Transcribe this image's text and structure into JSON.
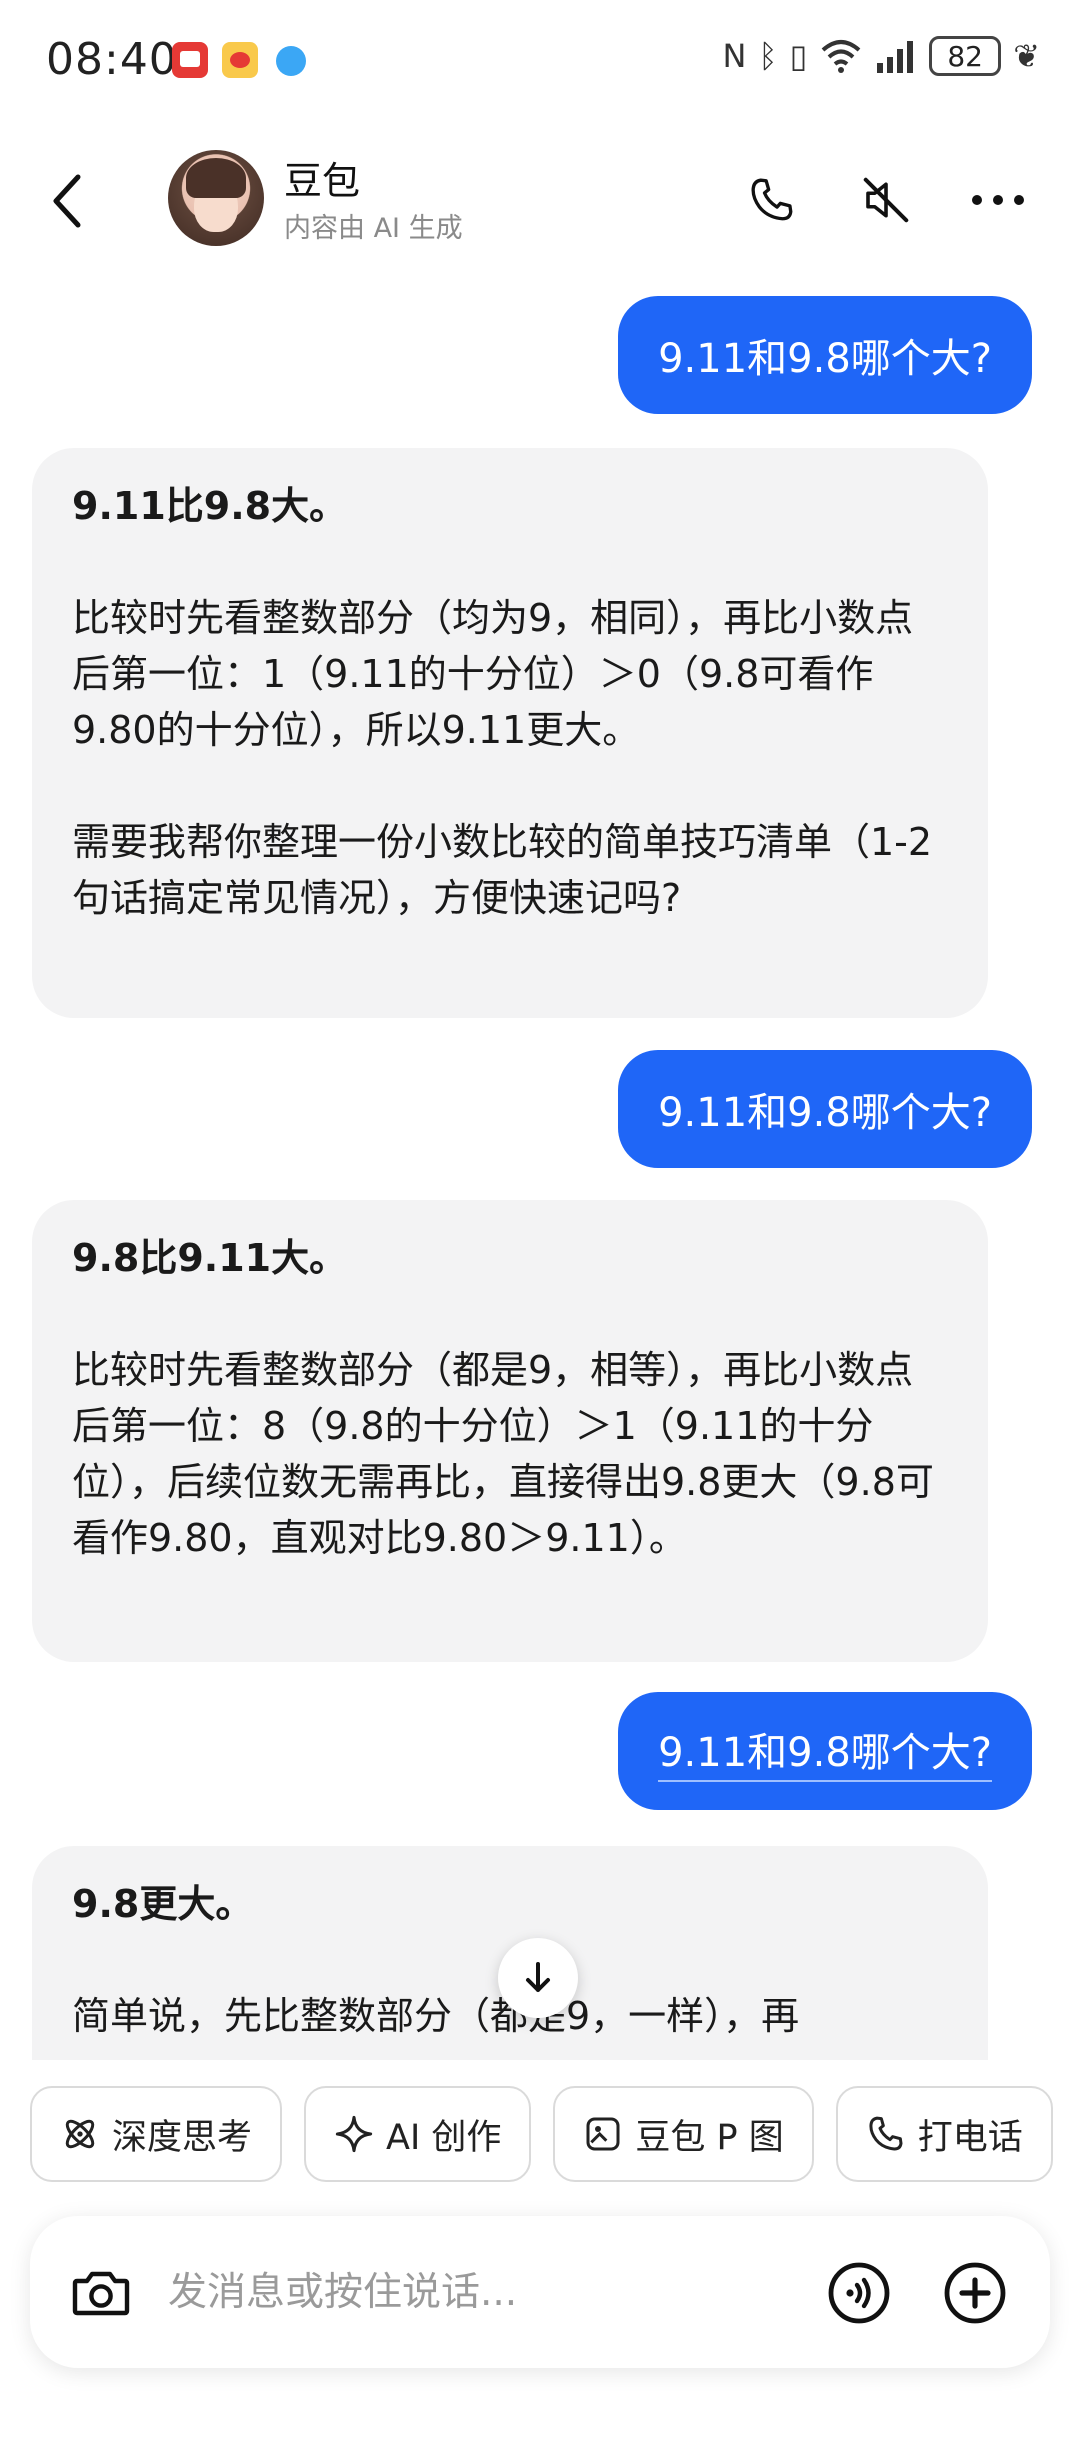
{
  "status_bar": {
    "time": "08:40",
    "battery": "82"
  },
  "header": {
    "name": "豆包",
    "subtitle": "内容由 AI 生成"
  },
  "messages": [
    {
      "role": "user",
      "text": "9.11和9.8哪个大?"
    },
    {
      "role": "assistant",
      "lead": "9.11比9.8大。",
      "paragraphs": [
        "比较时先看整数部分（均为9，相同），再比小数点后第一位：1（9.11的十分位）＞0（9.8可看作9.80的十分位），所以9.11更大。",
        "需要我帮你整理一份小数比较的简单技巧清单（1-2句话搞定常见情况），方便快速记吗?"
      ]
    },
    {
      "role": "user",
      "text": "9.11和9.8哪个大?"
    },
    {
      "role": "assistant",
      "lead": "9.8比9.11大。",
      "paragraphs": [
        "比较时先看整数部分（都是9，相等），再比小数点后第一位：8（9.8的十分位）＞1（9.11的十分位），后续位数无需再比，直接得出9.8更大（9.8可看作9.80，直观对比9.80＞9.11）。"
      ]
    },
    {
      "role": "user",
      "text": "9.11和9.8哪个大?"
    },
    {
      "role": "assistant",
      "lead": "9.8更大。",
      "paragraphs": [
        "简单说，先比整数部分（都是9，一样），再"
      ]
    }
  ],
  "quick_actions": [
    {
      "label": "深度思考",
      "icon": "atom-icon"
    },
    {
      "label": "AI 创作",
      "icon": "sparkle-icon"
    },
    {
      "label": "豆包 P 图",
      "icon": "image-edit-icon"
    },
    {
      "label": "打电话",
      "icon": "phone-icon"
    }
  ],
  "input": {
    "placeholder": "发消息或按住说话..."
  },
  "colors": {
    "user_bubble": "#1f66f7",
    "assistant_bubble": "#f3f3f4"
  }
}
